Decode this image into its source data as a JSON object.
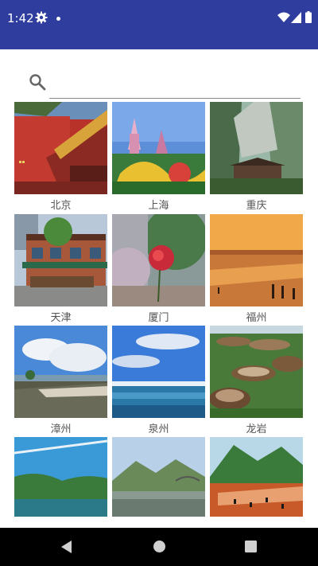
{
  "status_bar": {
    "time": "1:42",
    "icons": [
      "gear-icon",
      "notification-dot-icon",
      "wifi-icon",
      "signal-icon",
      "battery-icon"
    ],
    "background": "#2f3e9e"
  },
  "search": {
    "placeholder": "",
    "value": "",
    "icon": "search-icon"
  },
  "cities": [
    {
      "label": "北京"
    },
    {
      "label": "上海"
    },
    {
      "label": "重庆"
    },
    {
      "label": "天津"
    },
    {
      "label": "厦门"
    },
    {
      "label": "福州"
    },
    {
      "label": "漳州"
    },
    {
      "label": "泉州"
    },
    {
      "label": "龙岩"
    },
    {
      "label": ""
    },
    {
      "label": ""
    },
    {
      "label": ""
    }
  ],
  "nav_bar": {
    "icons": [
      "back-icon",
      "home-icon",
      "recent-apps-icon"
    ]
  }
}
